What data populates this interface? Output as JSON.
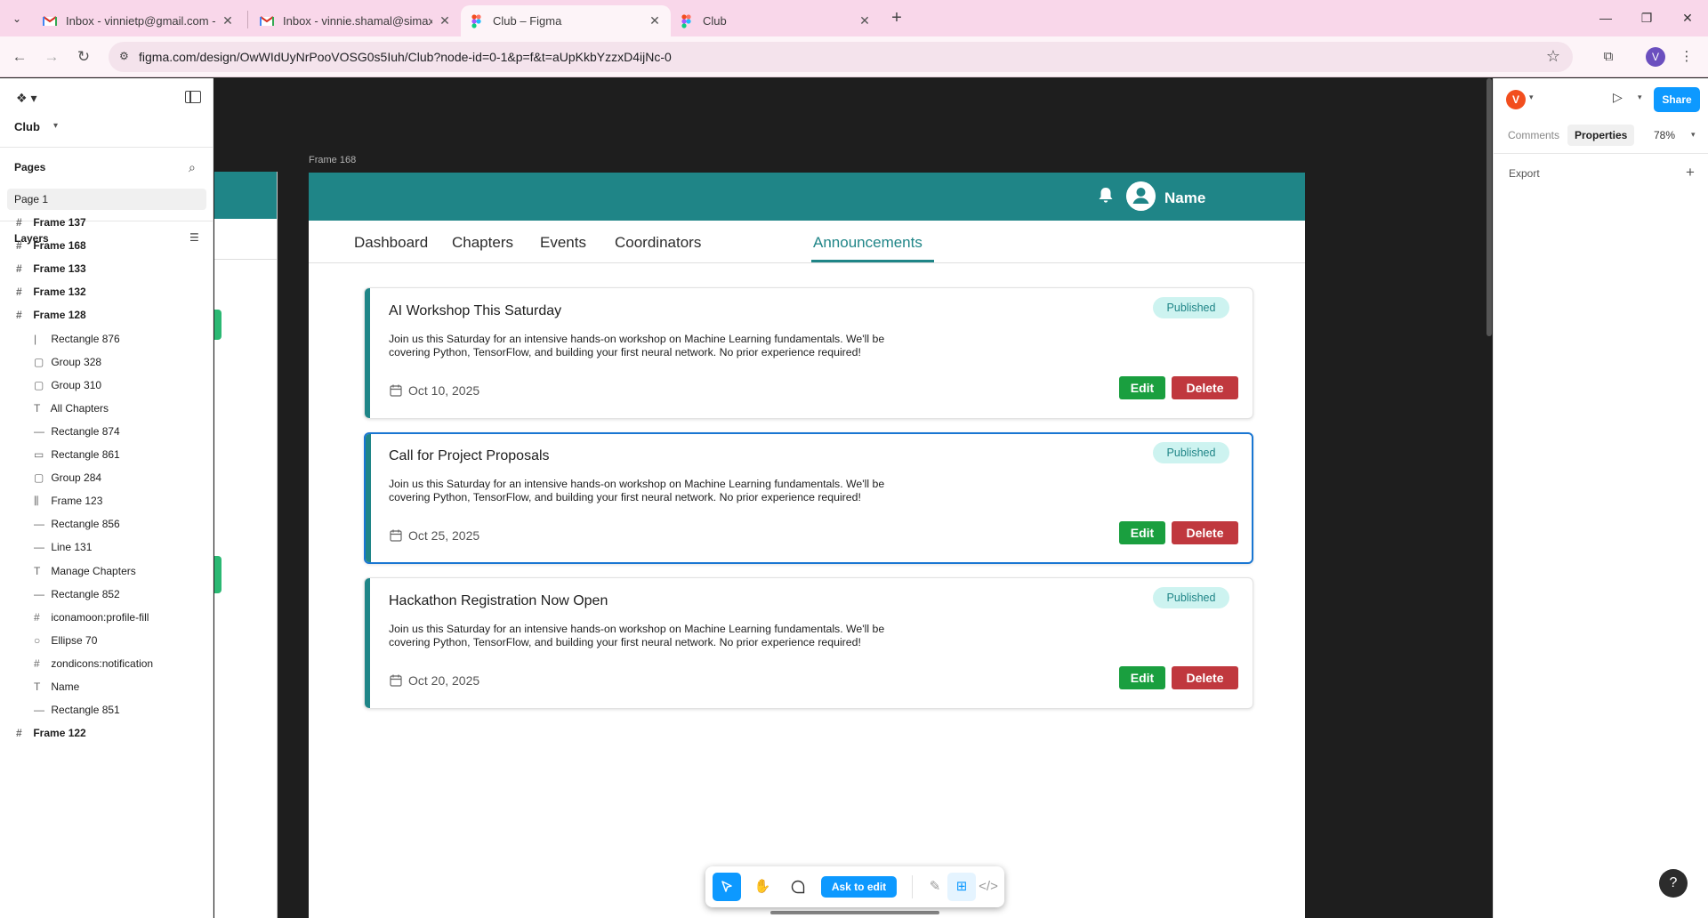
{
  "browser": {
    "tabs": [
      {
        "title": "Inbox - vinnietp@gmail.com - G",
        "icon": "gmail-icon"
      },
      {
        "title": "Inbox - vinnie.shamal@simaxsy",
        "icon": "gmail-icon"
      },
      {
        "title": "Club – Figma",
        "icon": "figma-icon"
      },
      {
        "title": "Club",
        "icon": "figma-icon"
      }
    ],
    "url": "figma.com/design/OwWIdUyNrPooVOSG0s5Iuh/Club?node-id=0-1&p=f&t=aUpKkbYzzxD4ijNc-0",
    "profile_initial": "V"
  },
  "left_panel": {
    "file_name": "Club",
    "pages_title": "Pages",
    "page": "Page 1",
    "layers_title": "Layers",
    "layers": [
      {
        "name": "Frame 137",
        "icon": "frame-icon",
        "level": 0
      },
      {
        "name": "Frame 168",
        "icon": "frame-icon",
        "level": 0
      },
      {
        "name": "Frame 133",
        "icon": "frame-icon",
        "level": 0
      },
      {
        "name": "Frame 132",
        "icon": "frame-icon",
        "level": 0
      },
      {
        "name": "Frame 128",
        "icon": "frame-icon",
        "level": 0
      },
      {
        "name": "Rectangle 876",
        "icon": "vertical-line-icon",
        "level": 1
      },
      {
        "name": "Group 328",
        "icon": "group-icon",
        "level": 1
      },
      {
        "name": "Group 310",
        "icon": "group-icon",
        "level": 1
      },
      {
        "name": "All Chapters",
        "icon": "text-icon",
        "level": 1
      },
      {
        "name": "Rectangle 874",
        "icon": "line-icon",
        "level": 1
      },
      {
        "name": "Rectangle 861",
        "icon": "rectangle-icon",
        "level": 1
      },
      {
        "name": "Group 284",
        "icon": "group-icon",
        "level": 1
      },
      {
        "name": "Frame 123",
        "icon": "auto-layout-icon",
        "level": 1
      },
      {
        "name": "Rectangle 856",
        "icon": "line-icon",
        "level": 1
      },
      {
        "name": "Line 131",
        "icon": "line-icon",
        "level": 1
      },
      {
        "name": "Manage Chapters",
        "icon": "text-icon",
        "level": 1
      },
      {
        "name": "Rectangle 852",
        "icon": "line-icon",
        "level": 1
      },
      {
        "name": "iconamoon:profile-fill",
        "icon": "frame-icon",
        "level": 1
      },
      {
        "name": "Ellipse 70",
        "icon": "ellipse-icon",
        "level": 1
      },
      {
        "name": "zondicons:notification",
        "icon": "frame-icon",
        "level": 1
      },
      {
        "name": "Name",
        "icon": "text-icon",
        "level": 1
      },
      {
        "name": "Rectangle 851",
        "icon": "line-icon",
        "level": 1
      },
      {
        "name": "Frame 122",
        "icon": "frame-icon",
        "level": 0
      }
    ]
  },
  "canvas": {
    "frame_label": "Frame 168",
    "header": {
      "user_name": "Name"
    },
    "nav": {
      "tabs": [
        "Dashboard",
        "Chapters",
        "Events",
        "Coordinators",
        "Announcements"
      ],
      "active": "Announcements"
    },
    "announcements": [
      {
        "title": "AI Workshop This Saturday",
        "status": "Published",
        "body": "Join us this Saturday for an intensive hands-on workshop on Machine Learning fundamentals. We'll be covering Python, TensorFlow, and building your first neural network. No prior experience required!",
        "date": "Oct 10, 2025",
        "edit_label": "Edit",
        "delete_label": "Delete"
      },
      {
        "title": "Call for Project Proposals",
        "status": "Published",
        "body": "Join us this Saturday for an intensive hands-on workshop on Machine Learning fundamentals. We'll be covering Python, TensorFlow, and building your first neural network. No prior experience required!",
        "date": "Oct 25, 2025",
        "edit_label": "Edit",
        "delete_label": "Delete"
      },
      {
        "title": "Hackathon Registration Now Open",
        "status": "Published",
        "body": "Join us this Saturday for an intensive hands-on workshop on Machine Learning fundamentals. We'll be covering Python, TensorFlow, and building your first neural network. No prior experience required!",
        "date": "Oct 20, 2025",
        "edit_label": "Edit",
        "delete_label": "Delete"
      }
    ],
    "colors": {
      "teal": "#1f8587",
      "badge_bg": "#cdf3f0",
      "edit": "#1a9f3f",
      "delete": "#c0383e",
      "selection": "#1976d2"
    }
  },
  "bottom_toolbar": {
    "ask_label": "Ask to edit"
  },
  "right_panel": {
    "avatar_initial": "V",
    "share_label": "Share",
    "tabs": [
      "Comments",
      "Properties"
    ],
    "active_tab": "Properties",
    "zoom": "78%",
    "export_title": "Export"
  }
}
